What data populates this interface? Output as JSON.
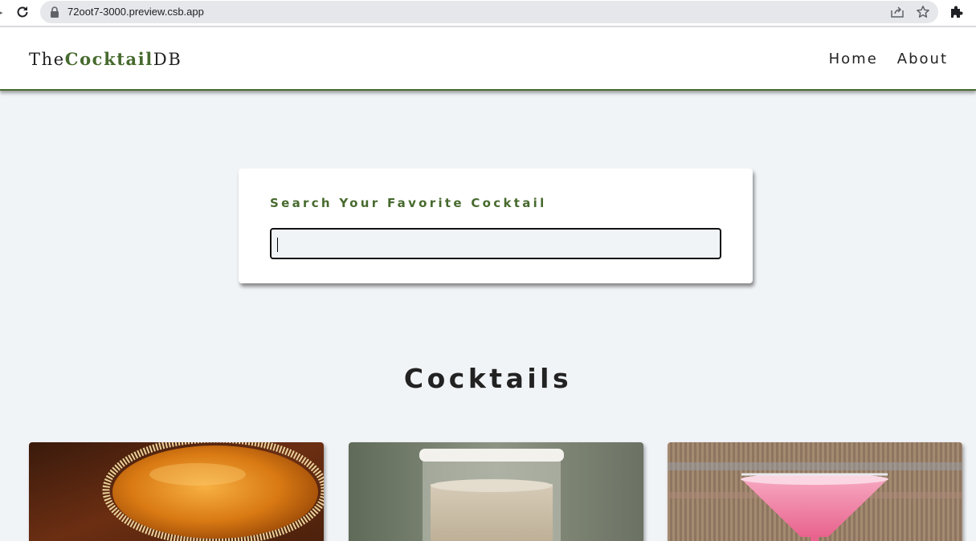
{
  "browser": {
    "url": "72oot7-3000.preview.csb.app",
    "icons": [
      "back-arrow-icon",
      "reload-icon",
      "lock-icon",
      "share-icon",
      "star-icon",
      "extensions-icon"
    ]
  },
  "navbar": {
    "logo": {
      "prefix": "The",
      "highlight": "Cocktail",
      "suffix": "DB"
    },
    "links": [
      {
        "label": "Home"
      },
      {
        "label": "About"
      }
    ]
  },
  "search": {
    "label": "Search Your Favorite Cocktail",
    "value": "",
    "placeholder": ""
  },
  "section": {
    "title": "Cocktails"
  },
  "colors": {
    "accent": "#476a2e",
    "background": "#f1f4f7",
    "text": "#222222"
  }
}
